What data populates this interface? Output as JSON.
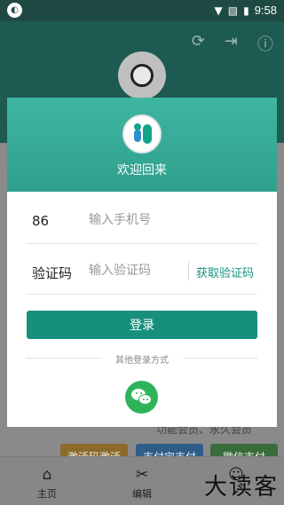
{
  "statusbar": {
    "time": "9:58",
    "left_icon": "app-notification-icon"
  },
  "background": {
    "toolbar_icons": [
      "sync-icon",
      "logout-icon",
      "info-icon"
    ],
    "row_text": "功能会员、永久会员",
    "buttons": [
      "激活码激活",
      "支付宝支付",
      "微信支付"
    ],
    "tabs": [
      {
        "icon": "home-icon",
        "label": "主页"
      },
      {
        "icon": "tools-icon",
        "label": "编辑"
      },
      {
        "icon": "profile-icon",
        "label": ""
      }
    ],
    "watermark": "大读客"
  },
  "dialog": {
    "title": "欢迎回来",
    "phone": {
      "prefix": "86",
      "placeholder": "输入手机号"
    },
    "code": {
      "label": "验证码",
      "placeholder": "输入验证码",
      "get_code": "获取验证码"
    },
    "login_label": "登录",
    "other_methods": "其他登录方式",
    "accent": "#16907d",
    "wechat_color": "#2fb35a"
  }
}
